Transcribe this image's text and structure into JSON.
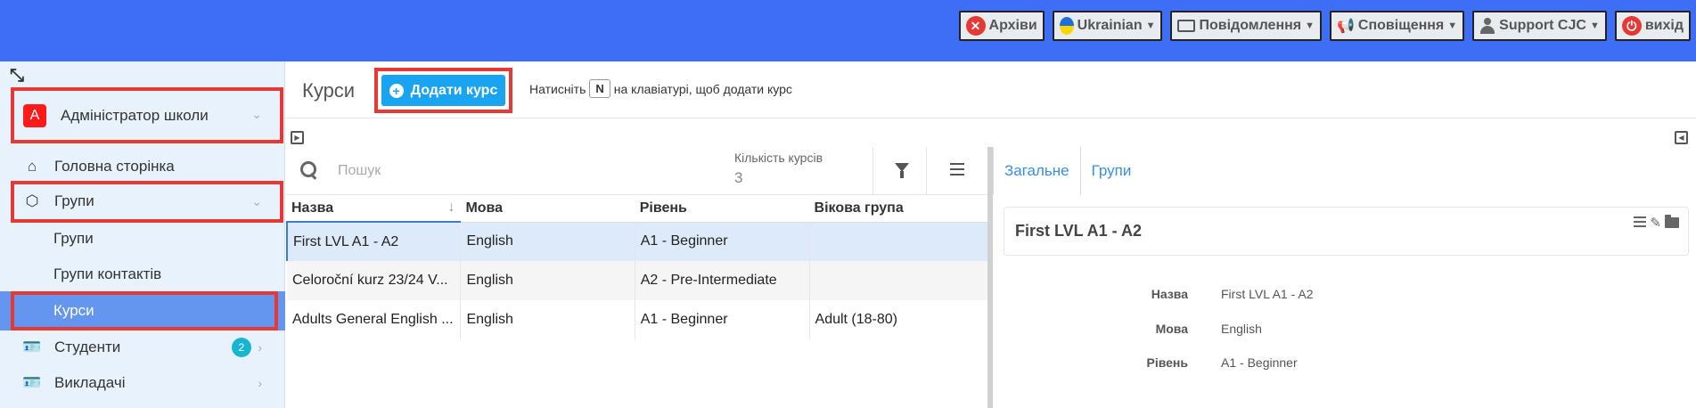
{
  "topbar": {
    "archive": "Архіви",
    "language": "Ukrainian",
    "messages": "Повідомлення",
    "notifications": "Сповіщення",
    "user": "Support CJC",
    "logout": "вихід",
    "color": "#3d6ef5"
  },
  "sidebar": {
    "school_avatar": "A",
    "school_name": "Адміністратор школи",
    "items": {
      "home": "Головна сторінка",
      "groups": "Групи",
      "groups_sub": "Групи",
      "contact_groups": "Групи контактів",
      "courses": "Курси",
      "students": "Студенти",
      "students_badge": "2",
      "teachers": "Викладачі"
    }
  },
  "header": {
    "title": "Курси",
    "add_button": "Додати курс",
    "hint_before": "Натисніть",
    "hint_key": "N",
    "hint_after": "на клавіатурі, щоб додати курс"
  },
  "list": {
    "search_placeholder": "Пошук",
    "count_label": "Кількість курсів",
    "count_value": "3",
    "columns": [
      "Назва",
      "Мова",
      "Рівень",
      "Вікова група"
    ],
    "rows": [
      [
        "First LVL A1 - A2",
        "English",
        "A1 - Beginner",
        ""
      ],
      [
        "Celoroční kurz 23/24 V...",
        "English",
        "A2 - Pre-Intermediate",
        ""
      ],
      [
        "Adults General English ...",
        "English",
        "A1 - Beginner",
        "Adult (18-80)"
      ]
    ]
  },
  "detail": {
    "tabs": [
      "Загальне",
      "Групи"
    ],
    "card_title": "First LVL A1 - A2",
    "fields": [
      {
        "label": "Назва",
        "value": "First LVL A1 - A2"
      },
      {
        "label": "Мова",
        "value": "English"
      },
      {
        "label": "Рівень",
        "value": "A1 - Beginner"
      }
    ]
  }
}
